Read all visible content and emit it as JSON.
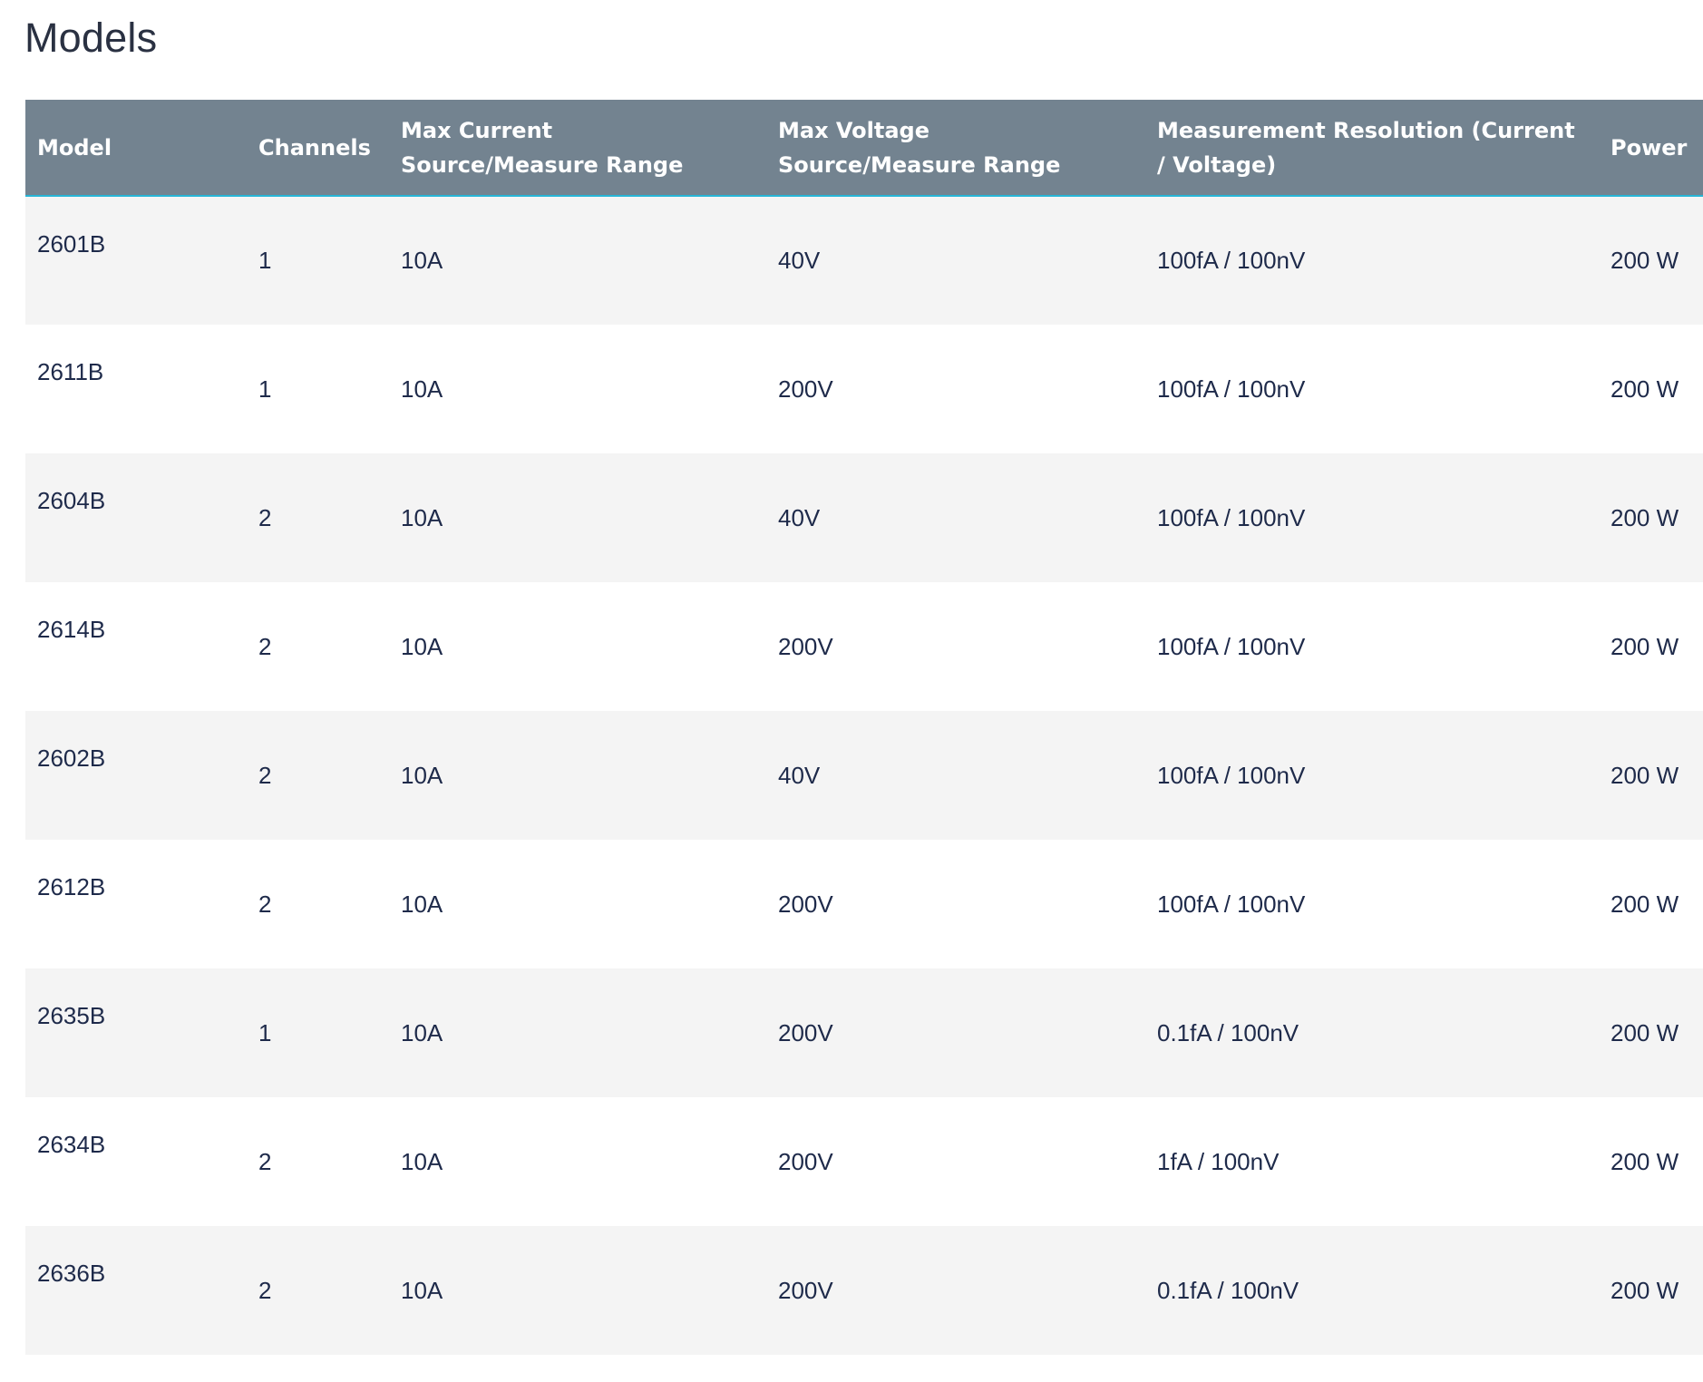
{
  "page": {
    "title": "Models"
  },
  "table": {
    "headers": {
      "model": "Model",
      "channels": "Channels",
      "max_current": "Max Current Source/Measure Range",
      "max_voltage": "Max Voltage Source/Measure Range",
      "resolution": "Measurement Resolution (Current / Voltage)",
      "power": "Power"
    },
    "rows": [
      {
        "model": "2601B",
        "channels": "1",
        "max_current": "10A",
        "max_voltage": "40V",
        "resolution": "100fA / 100nV",
        "power": "200 W"
      },
      {
        "model": "2611B",
        "channels": "1",
        "max_current": "10A",
        "max_voltage": "200V",
        "resolution": "100fA / 100nV",
        "power": "200 W"
      },
      {
        "model": "2604B",
        "channels": "2",
        "max_current": "10A",
        "max_voltage": "40V",
        "resolution": "100fA / 100nV",
        "power": "200 W"
      },
      {
        "model": "2614B",
        "channels": "2",
        "max_current": "10A",
        "max_voltage": "200V",
        "resolution": "100fA / 100nV",
        "power": "200 W"
      },
      {
        "model": "2602B",
        "channels": "2",
        "max_current": "10A",
        "max_voltage": "40V",
        "resolution": "100fA / 100nV",
        "power": "200 W"
      },
      {
        "model": "2612B",
        "channels": "2",
        "max_current": "10A",
        "max_voltage": "200V",
        "resolution": "100fA / 100nV",
        "power": "200 W"
      },
      {
        "model": "2635B",
        "channels": "1",
        "max_current": "10A",
        "max_voltage": "200V",
        "resolution": "0.1fA / 100nV",
        "power": "200 W"
      },
      {
        "model": "2634B",
        "channels": "2",
        "max_current": "10A",
        "max_voltage": "200V",
        "resolution": "1fA / 100nV",
        "power": "200 W"
      },
      {
        "model": "2636B",
        "channels": "2",
        "max_current": "10A",
        "max_voltage": "200V",
        "resolution": "0.1fA / 100nV",
        "power": "200 W"
      }
    ]
  },
  "colors": {
    "header_background": "#738390",
    "header_underline": "#27b5d6",
    "row_stripe": "#f4f4f4",
    "text": "#1e2a4a"
  }
}
